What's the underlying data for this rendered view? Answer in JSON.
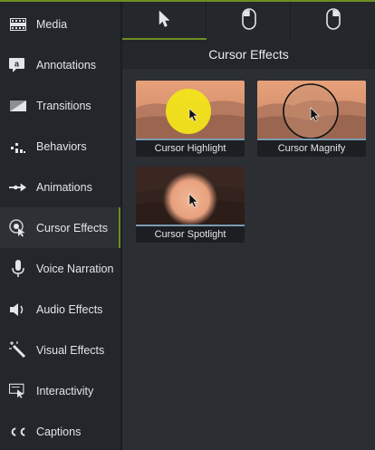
{
  "sidebar": {
    "items": [
      {
        "label": "Media",
        "icon": "film-strip-icon"
      },
      {
        "label": "Annotations",
        "icon": "annotation-callout-icon"
      },
      {
        "label": "Transitions",
        "icon": "transition-icon"
      },
      {
        "label": "Behaviors",
        "icon": "behaviors-icon"
      },
      {
        "label": "Animations",
        "icon": "animation-arrow-icon"
      },
      {
        "label": "Cursor Effects",
        "icon": "cursor-effects-icon"
      },
      {
        "label": "Voice Narration",
        "icon": "microphone-icon"
      },
      {
        "label": "Audio Effects",
        "icon": "speaker-icon"
      },
      {
        "label": "Visual Effects",
        "icon": "magic-wand-icon"
      },
      {
        "label": "Interactivity",
        "icon": "interactivity-icon"
      },
      {
        "label": "Captions",
        "icon": "cc-icon"
      }
    ],
    "active_item": "Cursor Effects"
  },
  "tabs": [
    {
      "name": "cursor-pointer-icon",
      "active": true
    },
    {
      "name": "mouse-left-click-icon",
      "active": false
    },
    {
      "name": "mouse-right-click-icon",
      "active": false
    }
  ],
  "panel": {
    "title": "Cursor Effects",
    "effects": [
      {
        "label": "Cursor Highlight"
      },
      {
        "label": "Cursor Magnify"
      },
      {
        "label": "Cursor Spotlight"
      }
    ]
  },
  "colors": {
    "accent": "#6b8e23",
    "sidebar_bg": "#23262b",
    "panel_bg": "#2b2e33",
    "text": "#e3e5e8",
    "highlight": "#f2e41a"
  }
}
